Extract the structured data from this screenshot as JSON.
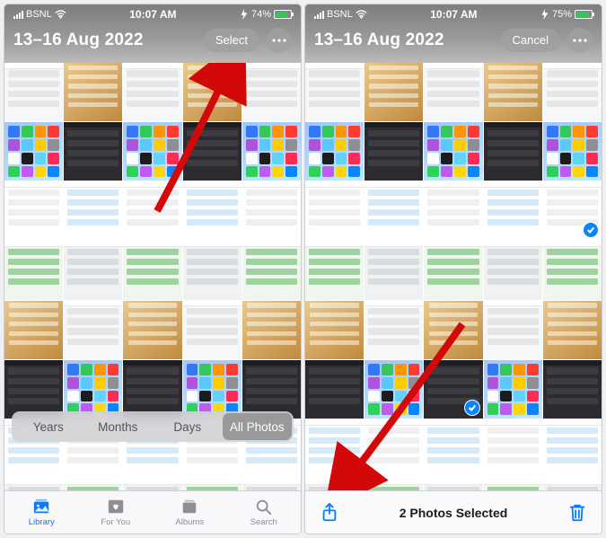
{
  "status": {
    "carrier": "BSNL",
    "time": "10:07 AM",
    "battery_pct": 74,
    "battery_label_left": "74%",
    "battery_label_right": "75%"
  },
  "left": {
    "date_title": "13–16 Aug 2022",
    "select_label": "Select",
    "segments": {
      "years": "Years",
      "months": "Months",
      "days": "Days",
      "all": "All Photos"
    },
    "tabs": {
      "library": "Library",
      "foryou": "For You",
      "albums": "Albums",
      "search": "Search"
    }
  },
  "right": {
    "date_title": "13–16 Aug 2022",
    "cancel_label": "Cancel",
    "selection_count_label": "2 Photos Selected"
  },
  "colors": {
    "ios_blue": "#0a7aff",
    "check_blue": "#0a84ff",
    "arrow_red": "#d30808"
  }
}
